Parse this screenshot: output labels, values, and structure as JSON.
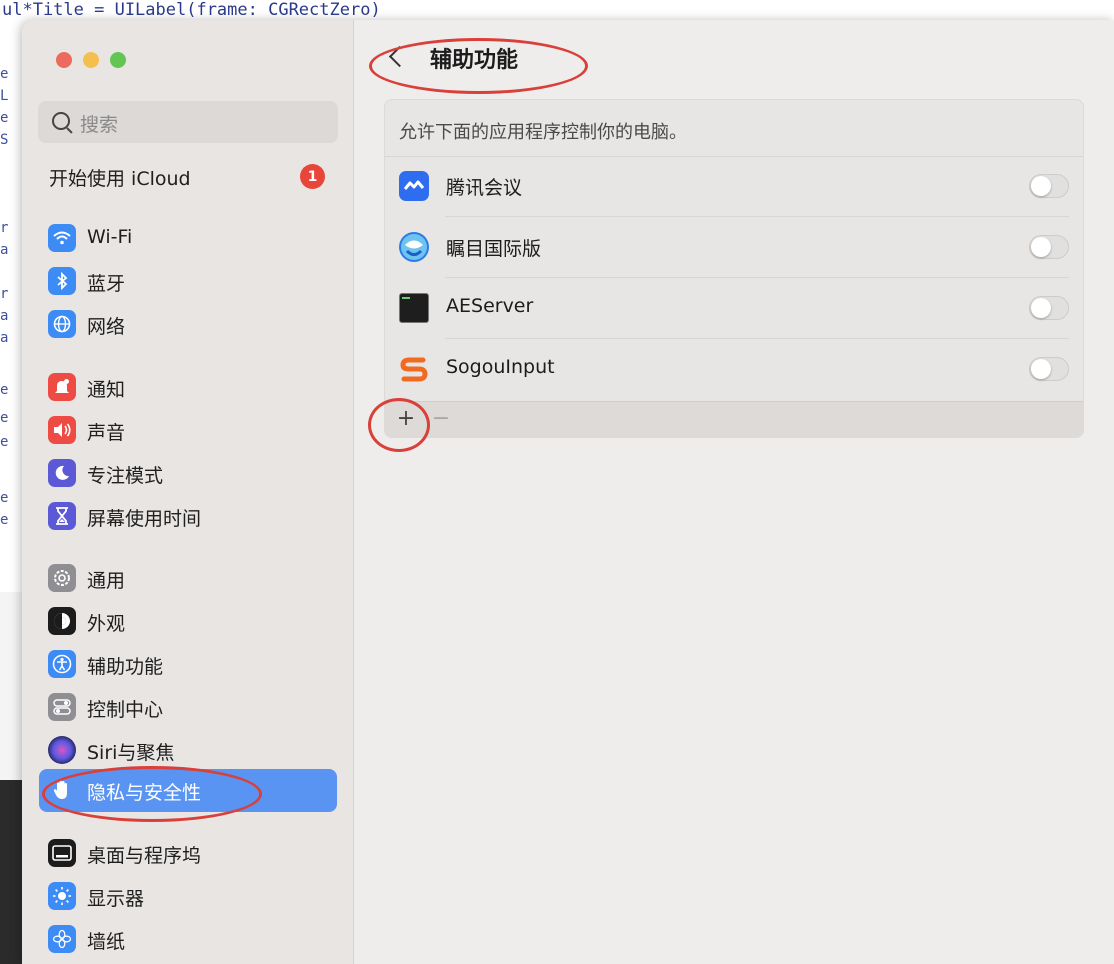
{
  "background": {
    "code_fragment": "ul*Title = UILabel(frame: CGRectZero)",
    "gutter_chars": [
      "e",
      "L",
      "e",
      "S",
      "r",
      "a",
      "r",
      "a",
      "a",
      "e",
      "e",
      "e",
      "e",
      "e"
    ],
    "lower_chars": [
      "",
      ""
    ]
  },
  "window": {
    "search": {
      "placeholder": "搜索"
    },
    "icloud": {
      "label": "开始使用 iCloud",
      "badge": "1"
    },
    "sidebar": {
      "items": [
        {
          "label": "Wi-Fi",
          "icon": "wifi-icon",
          "color": "#3d8bf5"
        },
        {
          "label": "蓝牙",
          "icon": "bluetooth-icon",
          "color": "#3d8bf5"
        },
        {
          "label": "网络",
          "icon": "globe-icon",
          "color": "#3d8bf5"
        },
        {
          "label": "通知",
          "icon": "bell-icon",
          "color": "#ee4b45"
        },
        {
          "label": "声音",
          "icon": "speaker-icon",
          "color": "#ee4b45"
        },
        {
          "label": "专注模式",
          "icon": "moon-icon",
          "color": "#5b59d6"
        },
        {
          "label": "屏幕使用时间",
          "icon": "hourglass-icon",
          "color": "#5b59d6"
        },
        {
          "label": "通用",
          "icon": "gear-icon",
          "color": "#8e8e93"
        },
        {
          "label": "外观",
          "icon": "appearance-icon",
          "color": "#1c1c1c"
        },
        {
          "label": "辅助功能",
          "icon": "accessibility-icon",
          "color": "#3d8bf5"
        },
        {
          "label": "控制中心",
          "icon": "control-center-icon",
          "color": "#8e8e93"
        },
        {
          "label": "Siri与聚焦",
          "icon": "siri-icon",
          "color": "#2f2f6f"
        },
        {
          "label": "隐私与安全性",
          "icon": "hand-icon",
          "color": "#3d8bf5",
          "selected": true
        },
        {
          "label": "桌面与程序坞",
          "icon": "dock-icon",
          "color": "#1c1c1c"
        },
        {
          "label": "显示器",
          "icon": "sun-icon",
          "color": "#3d8bf5"
        },
        {
          "label": "墙纸",
          "icon": "wallpaper-icon",
          "color": "#3d8bf5"
        }
      ]
    },
    "main": {
      "title": "辅助功能",
      "description": "允许下面的应用程序控制你的电脑。",
      "apps": [
        {
          "name": "腾讯会议",
          "icon": "tencent-meeting-icon",
          "enabled": false
        },
        {
          "name": "瞩目国际版",
          "icon": "zhumu-icon",
          "enabled": false
        },
        {
          "name": "AEServer",
          "icon": "terminal-icon",
          "enabled": false
        },
        {
          "name": "SogouInput",
          "icon": "sogou-icon",
          "enabled": false
        }
      ],
      "add_label": "+",
      "remove_label": "−"
    }
  },
  "colors": {
    "accent": "#5a94f3",
    "annotation": "#d9403a",
    "badge": "#e8463a"
  }
}
